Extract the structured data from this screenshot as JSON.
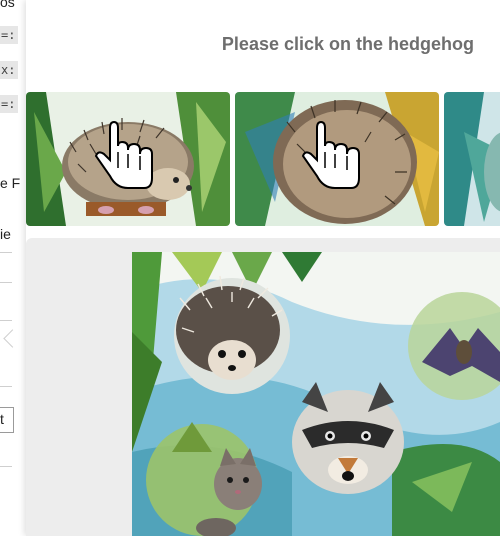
{
  "captcha": {
    "prompt": "Please click on the hedgehog",
    "thumbnails": [
      {
        "subject": "hedgehog",
        "icon": "hand-pointer-icon"
      },
      {
        "subject": "hedgehog",
        "icon": "hand-pointer-icon"
      },
      {
        "subject": "partial",
        "icon": ""
      }
    ],
    "preview_subjects": [
      "hedgehog",
      "raccoon",
      "bat",
      "cat"
    ]
  },
  "background_page": {
    "fragments": [
      "os",
      "=:",
      "x:",
      "=:",
      "e F",
      "ie",
      "t"
    ]
  }
}
